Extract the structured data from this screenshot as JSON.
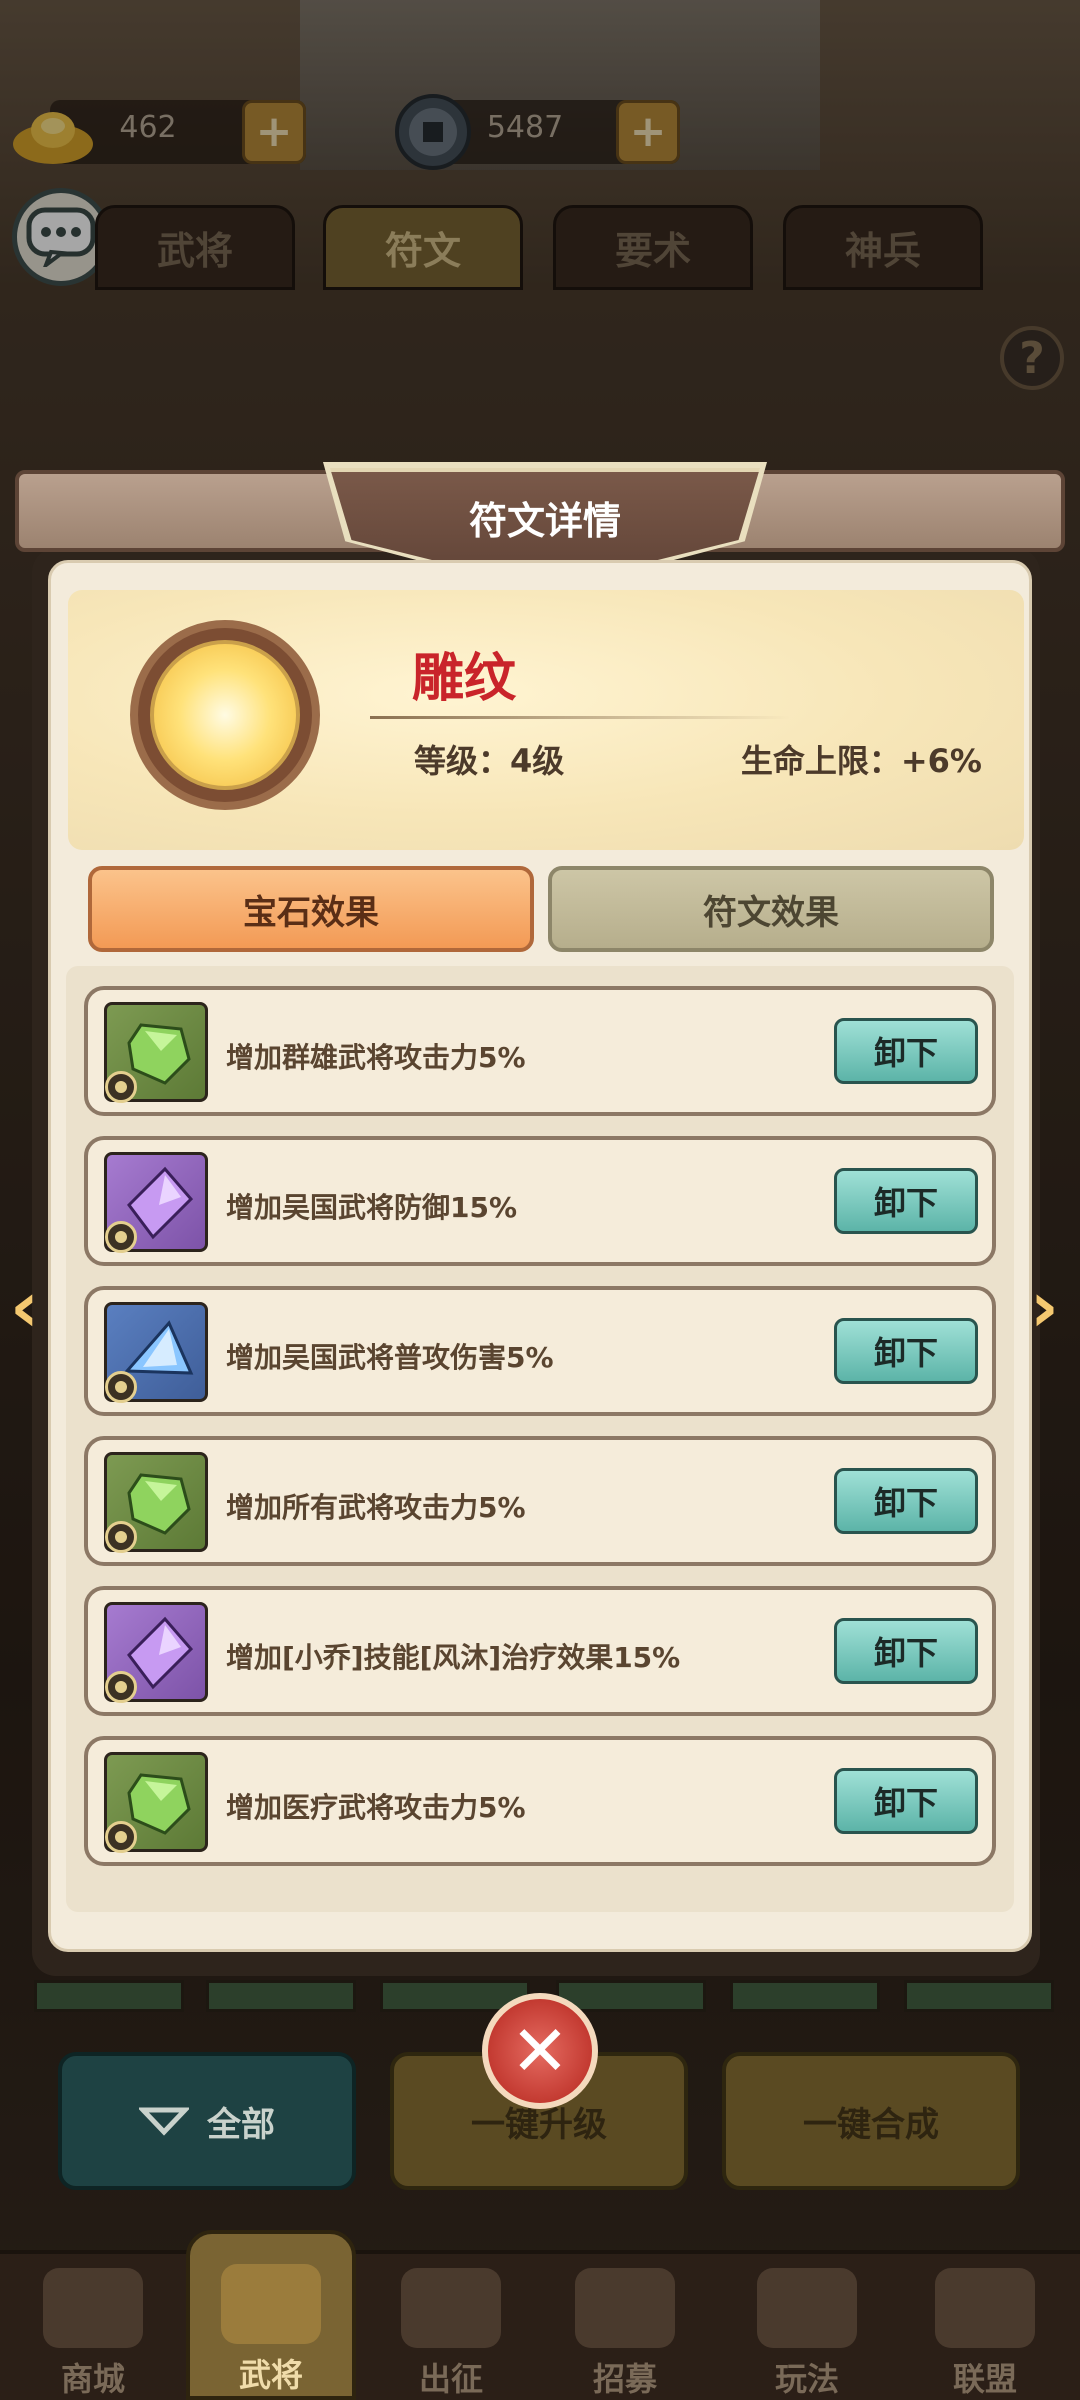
{
  "currency": {
    "gold": {
      "value": "462",
      "icon": "gold-ingot-icon"
    },
    "coins": {
      "value": "5487",
      "icon": "coin-icon"
    },
    "plus_label": "+"
  },
  "tabs": [
    {
      "label": "武将",
      "active": false
    },
    {
      "label": "符文",
      "active": true
    },
    {
      "label": "要术",
      "active": false
    },
    {
      "label": "神兵",
      "active": false
    }
  ],
  "help_label": "?",
  "modal": {
    "title": "符文详情",
    "rune_name": "雕纹",
    "level": "等级：4级",
    "stat": "生命上限：+6%",
    "tab_gem": "宝石效果",
    "tab_rune": "符文效果",
    "unload_label": "卸下",
    "rows": [
      {
        "text": "增加群雄武将攻击力5%",
        "gem": "green"
      },
      {
        "text": "增加吴国武将防御15%",
        "gem": "purple"
      },
      {
        "text": "增加吴国武将普攻伤害5%",
        "gem": "blue"
      },
      {
        "text": "增加所有武将攻击力5%",
        "gem": "green"
      },
      {
        "text": "增加[小乔]技能[风沐]治疗效果15%",
        "gem": "purple"
      },
      {
        "text": "增加医疗武将攻击力5%",
        "gem": "green"
      }
    ]
  },
  "actions": {
    "all": "全部",
    "upgrade": "一键升级",
    "merge": "一键合成"
  },
  "nav": [
    {
      "label": "商城",
      "active": false
    },
    {
      "label": "武将",
      "active": true
    },
    {
      "label": "出征",
      "active": false
    },
    {
      "label": "招募",
      "active": false
    },
    {
      "label": "玩法",
      "active": false
    },
    {
      "label": "联盟",
      "active": false
    }
  ],
  "colors": {
    "accent": "#f39a55",
    "teal_button": "#5cb4a8",
    "rune_name": "#c9242a"
  }
}
